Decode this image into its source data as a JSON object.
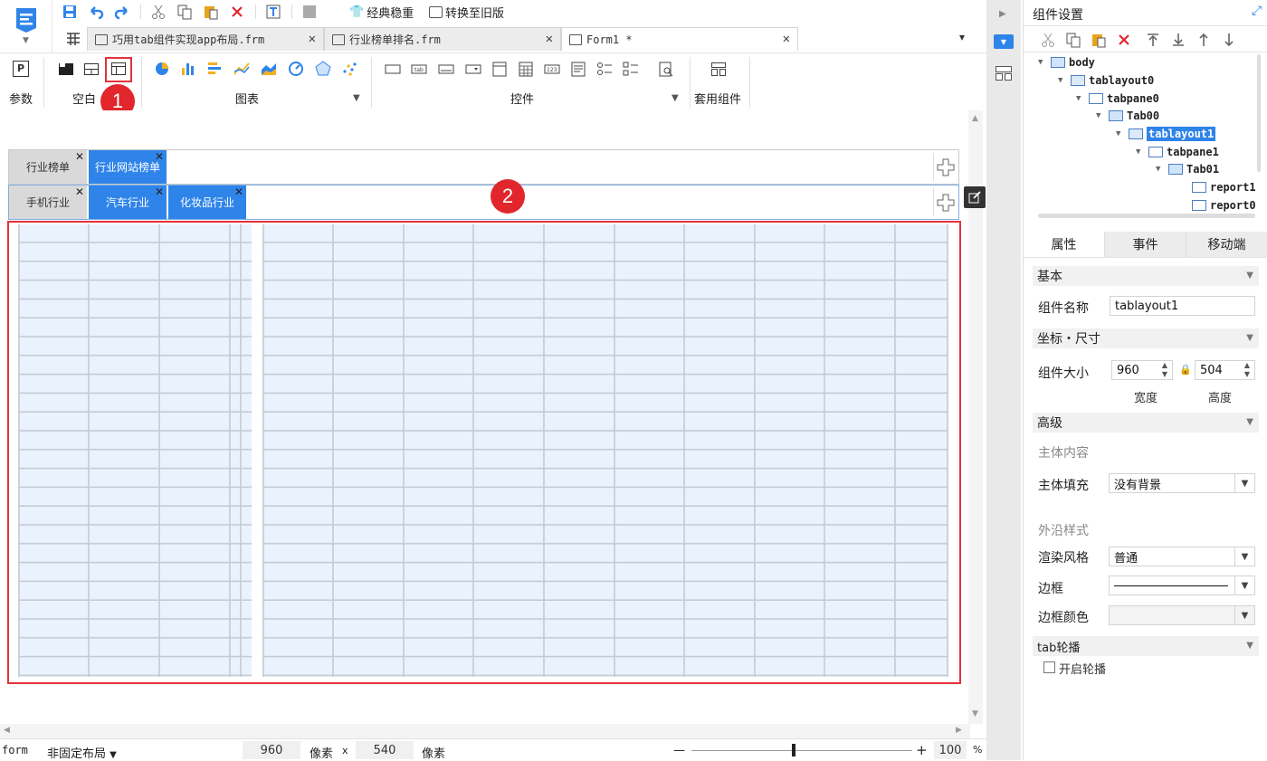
{
  "quick_access": {
    "classic_label": "经典稳重",
    "switch_label": "转换至旧版"
  },
  "file_tabs": [
    {
      "label": "巧用tab组件实现app布局.frm"
    },
    {
      "label": "行业榜单排名.frm"
    },
    {
      "label": "Form1 *"
    }
  ],
  "ribbon": {
    "param_label": "参数",
    "blank_label": "空白",
    "chart_label": "图表",
    "control_label": "控件",
    "template_label": "套用组件"
  },
  "canvas": {
    "top_tabs": [
      "行业榜单",
      "行业网站榜单"
    ],
    "sub_tabs": [
      "手机行业",
      "汽车行业",
      "化妆品行业"
    ],
    "badge1": "1",
    "badge2": "2"
  },
  "status": {
    "form_label": "form",
    "layout_label": "非固定布局",
    "width": "960",
    "unit1": "像素",
    "times": "x",
    "height": "540",
    "unit2": "像素",
    "minus": "—",
    "plus": "+",
    "zoom": "100",
    "percent": "%"
  },
  "panel": {
    "title": "组件设置",
    "tree": [
      {
        "label": "body"
      },
      {
        "label": "tablayout0"
      },
      {
        "label": "tabpane0"
      },
      {
        "label": "Tab00"
      },
      {
        "label": "tablayout1"
      },
      {
        "label": "tabpane1"
      },
      {
        "label": "Tab01"
      },
      {
        "label": "report1"
      },
      {
        "label": "report0"
      }
    ],
    "tabs": [
      "属性",
      "事件",
      "移动端"
    ],
    "basic": "基本",
    "name_label": "组件名称",
    "name_value": "tablayout1",
    "coord": "坐标・尺寸",
    "size_label": "组件大小",
    "size_w": "960",
    "size_h": "504",
    "width_label": "宽度",
    "height_label": "高度",
    "advanced": "高级",
    "body_content": "主体内容",
    "fill_label": "主体填充",
    "fill_value": "没有背景",
    "edge_style": "外沿样式",
    "render_label": "渲染风格",
    "render_value": "普通",
    "border_label": "边框",
    "border_color_label": "边框颜色",
    "carousel": "tab轮播",
    "carousel_check": "开启轮播"
  }
}
